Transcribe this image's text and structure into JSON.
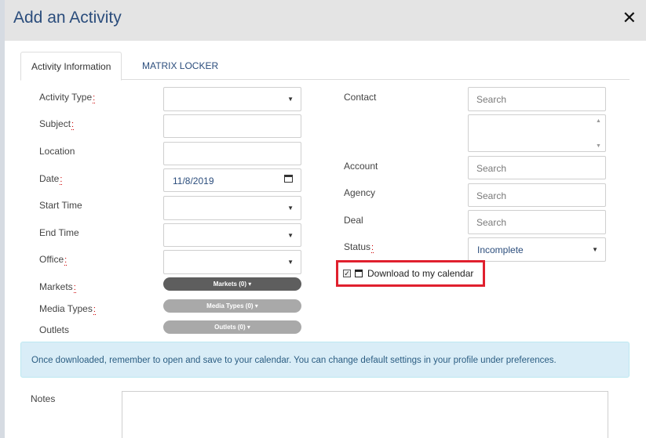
{
  "modal": {
    "title": "Add an Activity",
    "close_label": "✕"
  },
  "tabs": [
    {
      "label": "Activity Information",
      "active": true
    },
    {
      "label": "MATRIX LOCKER",
      "active": false
    }
  ],
  "left_form": {
    "activity_type": {
      "label": "Activity Type",
      "required": true,
      "value": ""
    },
    "subject": {
      "label": "Subject",
      "required": true,
      "value": ""
    },
    "location": {
      "label": "Location",
      "required": false,
      "value": ""
    },
    "date": {
      "label": "Date",
      "required": true,
      "value": "11/8/2019"
    },
    "start_time": {
      "label": "Start Time",
      "required": false,
      "value": ""
    },
    "end_time": {
      "label": "End Time",
      "required": false,
      "value": ""
    },
    "office": {
      "label": "Office",
      "required": true,
      "value": ""
    },
    "markets": {
      "label": "Markets",
      "required": true,
      "button": "Markets (0) ▾"
    },
    "media_types": {
      "label": "Media Types",
      "required": true,
      "button": "Media Types (0) ▾"
    },
    "outlets": {
      "label": "Outlets",
      "required": false,
      "button": "Outlets (0) ▾"
    }
  },
  "right_form": {
    "contact": {
      "label": "Contact",
      "placeholder": "Search"
    },
    "account": {
      "label": "Account",
      "placeholder": "Search"
    },
    "agency": {
      "label": "Agency",
      "placeholder": "Search"
    },
    "deal": {
      "label": "Deal",
      "placeholder": "Search"
    },
    "status": {
      "label": "Status",
      "required": true,
      "value": "Incomplete"
    }
  },
  "download": {
    "label": "Download to my calendar",
    "checked": true
  },
  "info_message": "Once downloaded, remember to open and save to your calendar. You can change default settings in your profile under preferences.",
  "notes": {
    "label": "Notes",
    "value": ""
  },
  "required_marker": ":",
  "colors": {
    "title": "#2b4d7c",
    "highlight_border": "#e0202e",
    "info_bg": "#d9edf7"
  }
}
